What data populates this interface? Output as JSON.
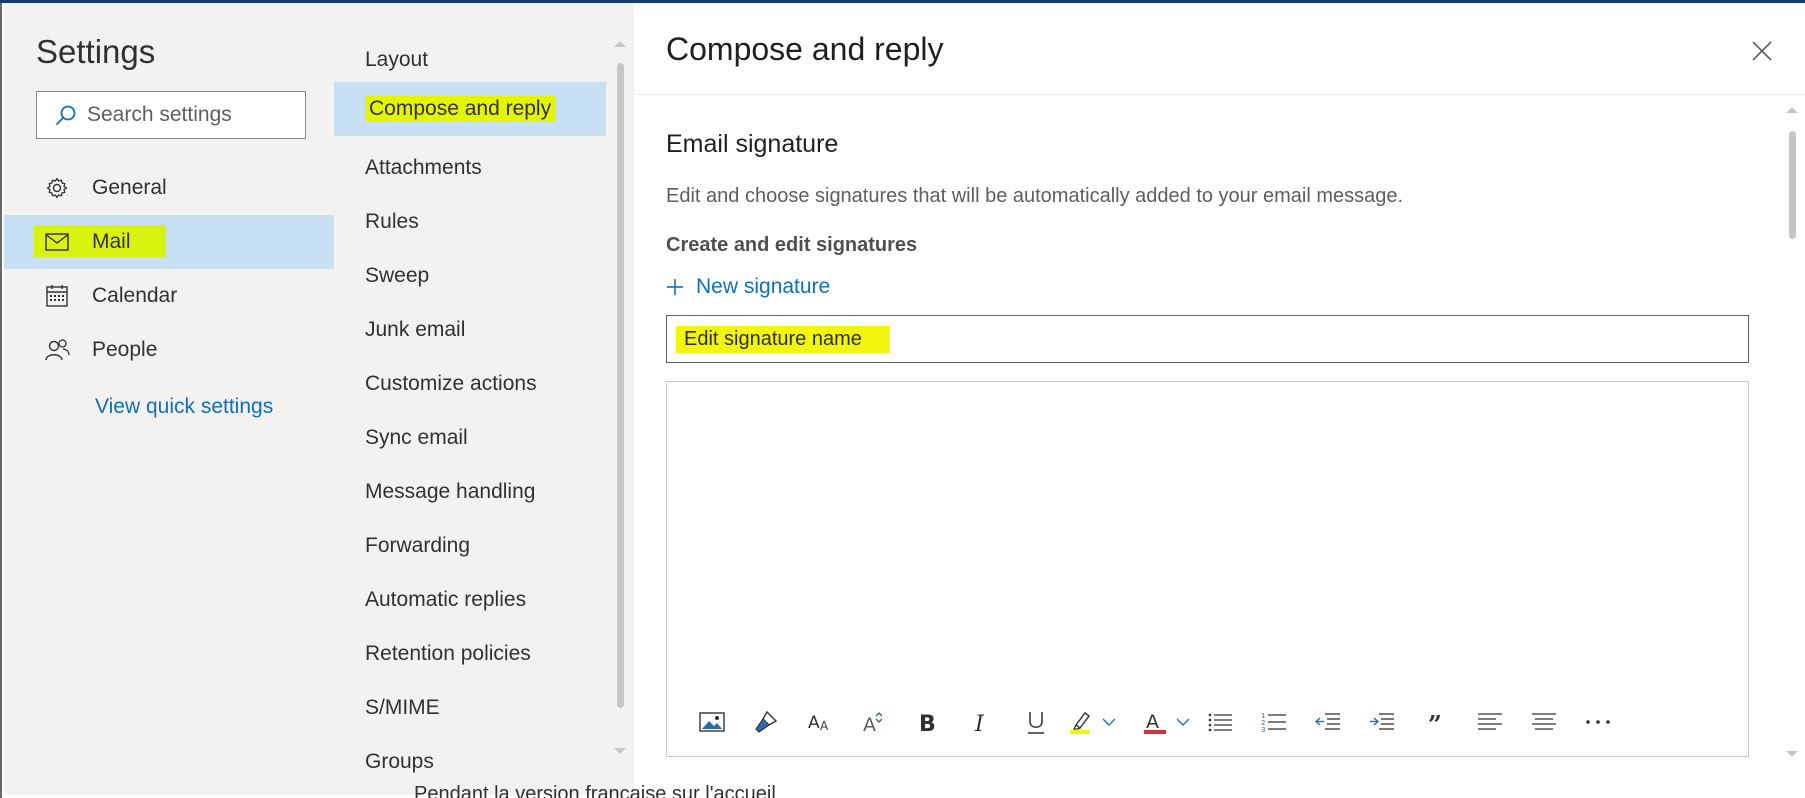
{
  "colors": {
    "accent": "#106ebe",
    "selected_bg": "#c7e0f4",
    "highlight": "#e3f500",
    "panel_bg": "#f3f2f1"
  },
  "settings": {
    "title": "Settings",
    "search_placeholder": "Search settings",
    "categories": [
      {
        "label": "General",
        "icon": "gear-icon"
      },
      {
        "label": "Mail",
        "icon": "mail-icon",
        "selected": true
      },
      {
        "label": "Calendar",
        "icon": "calendar-icon"
      },
      {
        "label": "People",
        "icon": "people-icon"
      }
    ],
    "quick_settings_link": "View quick settings"
  },
  "mail_menu": {
    "items": [
      {
        "label": "Layout"
      },
      {
        "label": "Compose and reply",
        "selected": true
      },
      {
        "label": "Attachments"
      },
      {
        "label": "Rules"
      },
      {
        "label": "Sweep"
      },
      {
        "label": "Junk email"
      },
      {
        "label": "Customize actions"
      },
      {
        "label": "Sync email"
      },
      {
        "label": "Message handling"
      },
      {
        "label": "Forwarding"
      },
      {
        "label": "Automatic replies"
      },
      {
        "label": "Retention policies"
      },
      {
        "label": "S/MIME"
      },
      {
        "label": "Groups"
      }
    ]
  },
  "content": {
    "title": "Compose and reply",
    "close_icon": "close-icon",
    "section_title": "Email signature",
    "section_desc": "Edit and choose signatures that will be automatically added to your email message.",
    "subsection_title": "Create and edit signatures",
    "new_signature_label": "New signature",
    "signature_name_placeholder": "Edit signature name",
    "toolbar_icons": [
      "insert-picture-icon",
      "format-painter-icon",
      "font-size-icon",
      "grow-font-icon",
      "bold-icon",
      "italic-icon",
      "underline-icon",
      "highlight-icon",
      "font-color-icon",
      "bullets-icon",
      "numbering-icon",
      "decrease-indent-icon",
      "increase-indent-icon",
      "quote-icon",
      "align-left-icon",
      "align-center-icon",
      "more-options-icon"
    ]
  },
  "background": {
    "peek_text": "Pendant la version française sur l'accueil"
  }
}
